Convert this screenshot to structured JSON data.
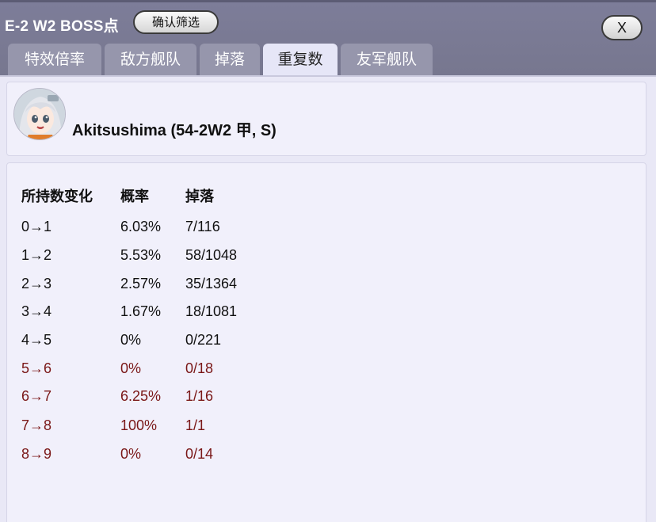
{
  "title": "E-2 W2 BOSS点",
  "filter_button": "确认筛选",
  "close_button": "X",
  "tabs": [
    {
      "label": "特效倍率"
    },
    {
      "label": "敌方舰队"
    },
    {
      "label": "掉落"
    },
    {
      "label": "重复数",
      "active": true
    },
    {
      "label": "友军舰队"
    }
  ],
  "ship": {
    "name": "Akitsushima (54-2W2 甲, S)",
    "avatar_icon": "ship-girl-avatar-icon"
  },
  "table": {
    "headers": [
      "所持数变化",
      "概率",
      "掉落"
    ],
    "rows": [
      {
        "change": "0→1",
        "rate": "6.03%",
        "drop": "7/116",
        "highlight": false
      },
      {
        "change": "1→2",
        "rate": "5.53%",
        "drop": "58/1048",
        "highlight": false
      },
      {
        "change": "2→3",
        "rate": "2.57%",
        "drop": "35/1364",
        "highlight": false
      },
      {
        "change": "3→4",
        "rate": "1.67%",
        "drop": "18/1081",
        "highlight": false
      },
      {
        "change": "4→5",
        "rate": "0%",
        "drop": "0/221",
        "highlight": false
      },
      {
        "change": "5→6",
        "rate": "0%",
        "drop": "0/18",
        "highlight": true
      },
      {
        "change": "6→7",
        "rate": "6.25%",
        "drop": "1/16",
        "highlight": true
      },
      {
        "change": "7→8",
        "rate": "100%",
        "drop": "1/1",
        "highlight": true
      },
      {
        "change": "8→9",
        "rate": "0%",
        "drop": "0/14",
        "highlight": true
      }
    ]
  },
  "colors": {
    "highlight_text": "#7a1717",
    "normal_text": "#111111",
    "tab_active_bg": "#e6e6f7",
    "tab_bg": "#9696ac"
  }
}
